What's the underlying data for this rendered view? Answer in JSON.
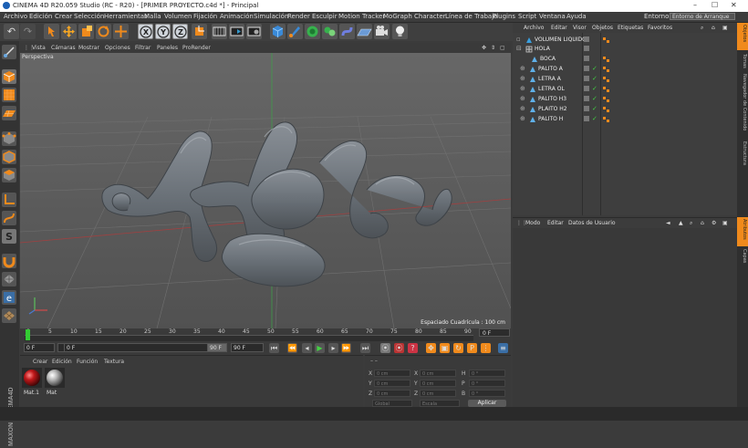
{
  "window": {
    "title": "CINEMA 4D R20.059 Studio (RC - R20) - [PRIMER PROYECTO.c4d *] - Principal"
  },
  "menu": [
    "Archivo",
    "Edición",
    "Crear",
    "Selección",
    "Herramientas",
    "Malla",
    "Volumen",
    "Fijación",
    "Animación",
    "Simulación",
    "Render",
    "Esculpir",
    "Motion Tracker",
    "MoGraph",
    "Character",
    "Línea de Trabajo",
    "Plugins",
    "Script",
    "Ventana",
    "Ayuda"
  ],
  "layout": {
    "label": "Entorno:",
    "value": "Entorno de Arranque"
  },
  "viewport": {
    "menu": [
      "Vista",
      "Cámaras",
      "Mostrar",
      "Opciones",
      "Filtrar",
      "Paneles",
      "ProRender"
    ],
    "label": "Perspectiva",
    "grid_spacing": "Espaciado Cuadrícula : 100 cm"
  },
  "timeline": {
    "ticks": [
      "0",
      "5",
      "10",
      "15",
      "20",
      "25",
      "30",
      "35",
      "40",
      "45",
      "50",
      "55",
      "60",
      "65",
      "70",
      "75",
      "80",
      "85",
      "90"
    ],
    "current_frame": "0 F",
    "start_frame": "0 F",
    "range_start": "0 F",
    "range_end": "90 F",
    "end_frame": "90 F"
  },
  "materials": {
    "menu": [
      "Crear",
      "Edición",
      "Función",
      "Textura"
    ],
    "items": [
      {
        "name": "Mat.1",
        "color": "#c0181a"
      },
      {
        "name": "Mat",
        "color": "#b8b8b8"
      }
    ]
  },
  "coordinates": {
    "rows": [
      {
        "a": "X",
        "av": "0 cm",
        "b": "X",
        "bv": "0 cm",
        "c": "H",
        "cv": "0 °"
      },
      {
        "a": "Y",
        "av": "0 cm",
        "b": "Y",
        "bv": "0 cm",
        "c": "P",
        "cv": "0 °"
      },
      {
        "a": "Z",
        "av": "0 cm",
        "b": "Z",
        "bv": "0 cm",
        "c": "B",
        "cv": "0 °"
      }
    ],
    "mode": "Global",
    "scale": "Escala",
    "apply": "Aplicar"
  },
  "objects": {
    "menu": [
      "Archivo",
      "Editar",
      "Visor",
      "Objetos",
      "Etiquetas",
      "Favoritos"
    ],
    "items": [
      {
        "name": "VOLUMEN LIQUIDO"
      },
      {
        "name": "HOLA"
      },
      {
        "name": "BOCA"
      },
      {
        "name": "PALITO A"
      },
      {
        "name": "LETRA A"
      },
      {
        "name": "LETRA OL"
      },
      {
        "name": "PALITO H3"
      },
      {
        "name": "PLAITO H2"
      },
      {
        "name": "PALITO H"
      }
    ]
  },
  "attributes": {
    "menu": [
      "Modo",
      "Editar",
      "Datos de Usuario"
    ]
  },
  "right_tabs": [
    "Objetos",
    "Tomas",
    "Navegador de Contenido",
    "Estructura",
    "Atributos",
    "Capas"
  ],
  "colors": {
    "accent": "#f08a1c",
    "background": "#3b3b3b",
    "viewport": "#5b5b5b",
    "object": "#6e747a"
  },
  "logo": {
    "text": "MAXON CINEMA 4D"
  }
}
